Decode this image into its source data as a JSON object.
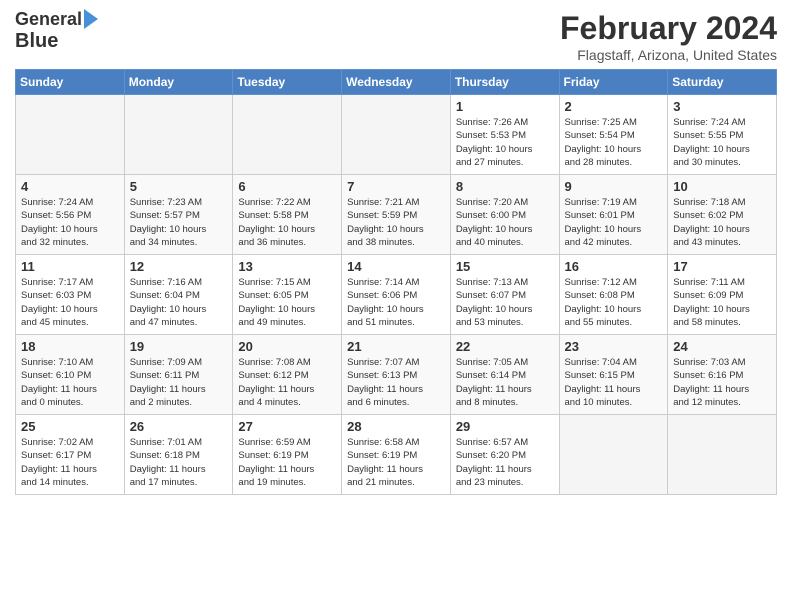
{
  "header": {
    "logo_line1": "General",
    "logo_line2": "Blue",
    "month": "February 2024",
    "location": "Flagstaff, Arizona, United States"
  },
  "days_of_week": [
    "Sunday",
    "Monday",
    "Tuesday",
    "Wednesday",
    "Thursday",
    "Friday",
    "Saturday"
  ],
  "weeks": [
    [
      {
        "day": "",
        "info": ""
      },
      {
        "day": "",
        "info": ""
      },
      {
        "day": "",
        "info": ""
      },
      {
        "day": "",
        "info": ""
      },
      {
        "day": "1",
        "info": "Sunrise: 7:26 AM\nSunset: 5:53 PM\nDaylight: 10 hours\nand 27 minutes."
      },
      {
        "day": "2",
        "info": "Sunrise: 7:25 AM\nSunset: 5:54 PM\nDaylight: 10 hours\nand 28 minutes."
      },
      {
        "day": "3",
        "info": "Sunrise: 7:24 AM\nSunset: 5:55 PM\nDaylight: 10 hours\nand 30 minutes."
      }
    ],
    [
      {
        "day": "4",
        "info": "Sunrise: 7:24 AM\nSunset: 5:56 PM\nDaylight: 10 hours\nand 32 minutes."
      },
      {
        "day": "5",
        "info": "Sunrise: 7:23 AM\nSunset: 5:57 PM\nDaylight: 10 hours\nand 34 minutes."
      },
      {
        "day": "6",
        "info": "Sunrise: 7:22 AM\nSunset: 5:58 PM\nDaylight: 10 hours\nand 36 minutes."
      },
      {
        "day": "7",
        "info": "Sunrise: 7:21 AM\nSunset: 5:59 PM\nDaylight: 10 hours\nand 38 minutes."
      },
      {
        "day": "8",
        "info": "Sunrise: 7:20 AM\nSunset: 6:00 PM\nDaylight: 10 hours\nand 40 minutes."
      },
      {
        "day": "9",
        "info": "Sunrise: 7:19 AM\nSunset: 6:01 PM\nDaylight: 10 hours\nand 42 minutes."
      },
      {
        "day": "10",
        "info": "Sunrise: 7:18 AM\nSunset: 6:02 PM\nDaylight: 10 hours\nand 43 minutes."
      }
    ],
    [
      {
        "day": "11",
        "info": "Sunrise: 7:17 AM\nSunset: 6:03 PM\nDaylight: 10 hours\nand 45 minutes."
      },
      {
        "day": "12",
        "info": "Sunrise: 7:16 AM\nSunset: 6:04 PM\nDaylight: 10 hours\nand 47 minutes."
      },
      {
        "day": "13",
        "info": "Sunrise: 7:15 AM\nSunset: 6:05 PM\nDaylight: 10 hours\nand 49 minutes."
      },
      {
        "day": "14",
        "info": "Sunrise: 7:14 AM\nSunset: 6:06 PM\nDaylight: 10 hours\nand 51 minutes."
      },
      {
        "day": "15",
        "info": "Sunrise: 7:13 AM\nSunset: 6:07 PM\nDaylight: 10 hours\nand 53 minutes."
      },
      {
        "day": "16",
        "info": "Sunrise: 7:12 AM\nSunset: 6:08 PM\nDaylight: 10 hours\nand 55 minutes."
      },
      {
        "day": "17",
        "info": "Sunrise: 7:11 AM\nSunset: 6:09 PM\nDaylight: 10 hours\nand 58 minutes."
      }
    ],
    [
      {
        "day": "18",
        "info": "Sunrise: 7:10 AM\nSunset: 6:10 PM\nDaylight: 11 hours\nand 0 minutes."
      },
      {
        "day": "19",
        "info": "Sunrise: 7:09 AM\nSunset: 6:11 PM\nDaylight: 11 hours\nand 2 minutes."
      },
      {
        "day": "20",
        "info": "Sunrise: 7:08 AM\nSunset: 6:12 PM\nDaylight: 11 hours\nand 4 minutes."
      },
      {
        "day": "21",
        "info": "Sunrise: 7:07 AM\nSunset: 6:13 PM\nDaylight: 11 hours\nand 6 minutes."
      },
      {
        "day": "22",
        "info": "Sunrise: 7:05 AM\nSunset: 6:14 PM\nDaylight: 11 hours\nand 8 minutes."
      },
      {
        "day": "23",
        "info": "Sunrise: 7:04 AM\nSunset: 6:15 PM\nDaylight: 11 hours\nand 10 minutes."
      },
      {
        "day": "24",
        "info": "Sunrise: 7:03 AM\nSunset: 6:16 PM\nDaylight: 11 hours\nand 12 minutes."
      }
    ],
    [
      {
        "day": "25",
        "info": "Sunrise: 7:02 AM\nSunset: 6:17 PM\nDaylight: 11 hours\nand 14 minutes."
      },
      {
        "day": "26",
        "info": "Sunrise: 7:01 AM\nSunset: 6:18 PM\nDaylight: 11 hours\nand 17 minutes."
      },
      {
        "day": "27",
        "info": "Sunrise: 6:59 AM\nSunset: 6:19 PM\nDaylight: 11 hours\nand 19 minutes."
      },
      {
        "day": "28",
        "info": "Sunrise: 6:58 AM\nSunset: 6:19 PM\nDaylight: 11 hours\nand 21 minutes."
      },
      {
        "day": "29",
        "info": "Sunrise: 6:57 AM\nSunset: 6:20 PM\nDaylight: 11 hours\nand 23 minutes."
      },
      {
        "day": "",
        "info": ""
      },
      {
        "day": "",
        "info": ""
      }
    ]
  ]
}
